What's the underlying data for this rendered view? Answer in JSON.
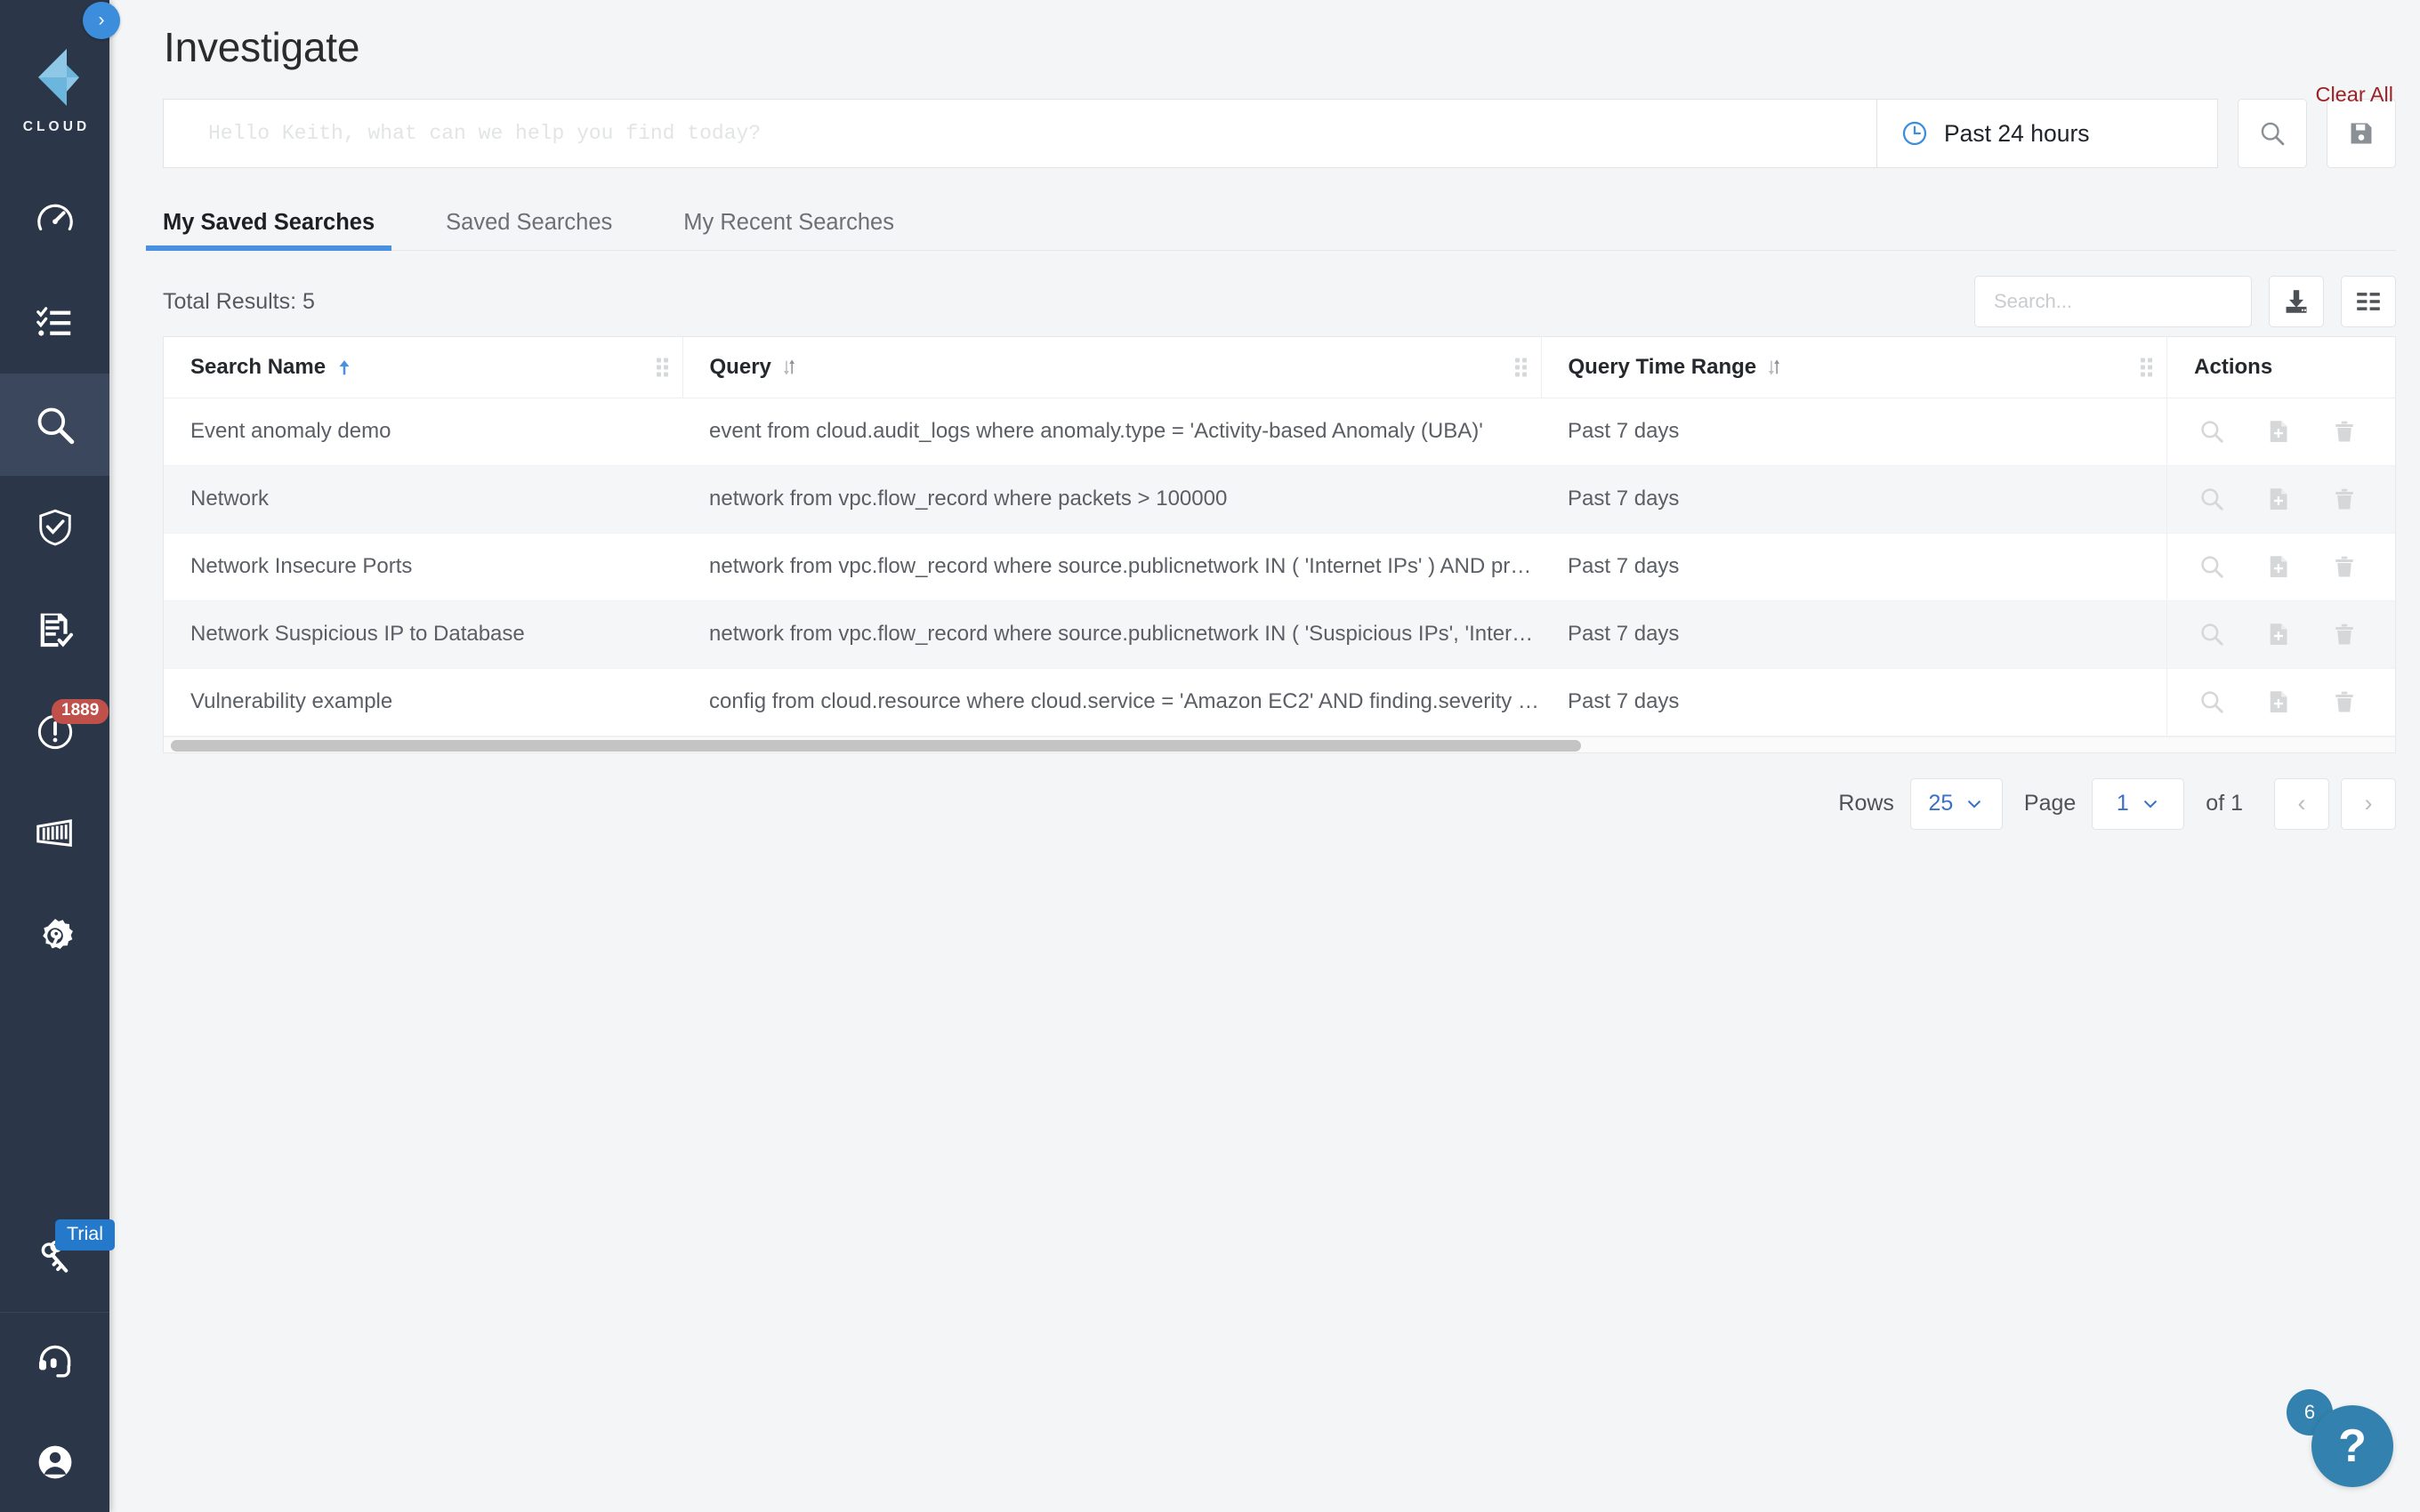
{
  "brand": {
    "name": "CLOUD",
    "logo_color": "#6cb5dd"
  },
  "sidebar": {
    "toggle_icon": "chevron-right-icon",
    "items": [
      {
        "name": "dashboard",
        "icon": "gauge-icon",
        "active": false
      },
      {
        "name": "compliance",
        "icon": "checklist-icon",
        "active": false
      },
      {
        "name": "investigate",
        "icon": "magnifier-icon",
        "active": true
      },
      {
        "name": "monitor",
        "icon": "shield-check-icon",
        "active": false
      },
      {
        "name": "reports",
        "icon": "document-check-icon",
        "active": false
      },
      {
        "name": "alerts",
        "icon": "alert-circle-icon",
        "active": false,
        "badge": "1889"
      },
      {
        "name": "containers",
        "icon": "container-icon",
        "active": false
      },
      {
        "name": "settings",
        "icon": "gear-wrench-icon",
        "active": false
      }
    ],
    "bottom_items": [
      {
        "name": "licensing",
        "icon": "keys-icon",
        "badge": "Trial"
      },
      {
        "name": "support",
        "icon": "headset-icon"
      },
      {
        "name": "profile",
        "icon": "user-circle-icon"
      }
    ]
  },
  "header": {
    "title": "Investigate",
    "clear_all_label": "Clear All",
    "clear_all_color": "#9b2226"
  },
  "search": {
    "placeholder": "Hello Keith, what can we help you find today?",
    "value": "",
    "time_range": "Past 24 hours",
    "time_icon": "clock-icon",
    "search_button_icon": "search-icon",
    "save_button_icon": "floppy-save-icon"
  },
  "tabs": [
    {
      "label": "My Saved Searches",
      "active": true
    },
    {
      "label": "Saved Searches",
      "active": false
    },
    {
      "label": "My Recent Searches",
      "active": false
    }
  ],
  "toolbar": {
    "total_results": "Total Results: 5",
    "table_search_placeholder": "Search...",
    "table_search_value": "",
    "download_icon": "download-icon",
    "columns_icon": "columns-view-icon"
  },
  "table": {
    "columns": [
      {
        "label": "Search Name",
        "sort": "asc",
        "sort_icon": "arrow-up-icon"
      },
      {
        "label": "Query",
        "sort": "none",
        "sort_icon": "sort-updown-icon"
      },
      {
        "label": "Query Time Range",
        "sort": "none",
        "sort_icon": "sort-updown-icon"
      },
      {
        "label": "Actions",
        "sort": null,
        "sort_icon": null
      }
    ],
    "row_actions": [
      "search-icon",
      "document-plus-icon",
      "trash-icon"
    ],
    "rows": [
      {
        "name": "Event anomaly demo",
        "query": "event from cloud.audit_logs where anomaly.type = 'Activity-based Anomaly (UBA)'",
        "time_range": "Past 7 days"
      },
      {
        "name": "Network",
        "query": "network from vpc.flow_record where packets > 100000",
        "time_range": "Past 7 days"
      },
      {
        "name": "Network Insecure Ports",
        "query": "network from vpc.flow_record where source.publicnetwork IN ( 'Internet IPs' ) AND pro…",
        "time_range": "Past 7 days"
      },
      {
        "name": "Network Suspicious IP to Database",
        "query": "network from vpc.flow_record where source.publicnetwork IN ( 'Suspicious IPs', 'Interne…",
        "time_range": "Past 7 days"
      },
      {
        "name": "Vulnerability example",
        "query": "config from cloud.resource where cloud.service = 'Amazon EC2' AND finding.severity = '…",
        "time_range": "Past 7 days"
      }
    ]
  },
  "pagination": {
    "rows_label": "Rows",
    "rows_value": "25",
    "page_label": "Page",
    "page_value": "1",
    "of_label": "of 1",
    "prev_icon": "chevron-left-icon",
    "next_icon": "chevron-right-icon"
  },
  "help": {
    "question_mark": "?",
    "count": "6",
    "color": "#3281ae"
  }
}
